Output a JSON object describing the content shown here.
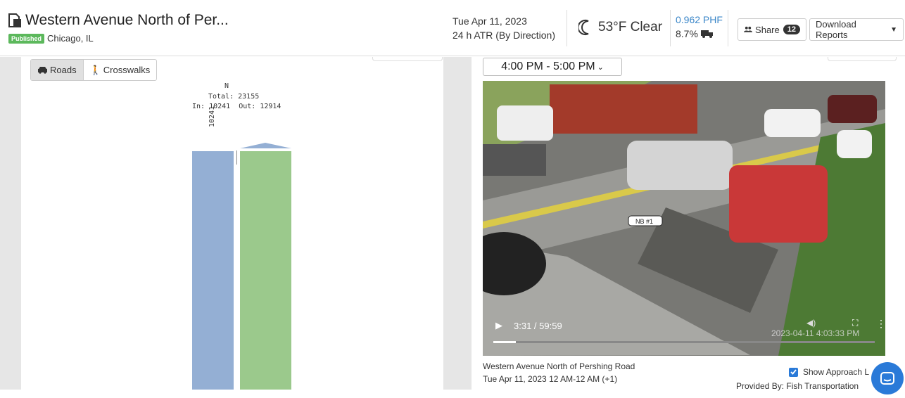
{
  "header": {
    "title": "Western Avenue North of Per...",
    "status_badge": "Published",
    "location": "Chicago, IL",
    "date": "Tue Apr 11, 2023",
    "report_type": "24 h ATR (By Direction)",
    "weather": "53°F Clear",
    "phf": "0.962 PHF",
    "truck_pct": "8.7%",
    "share_label": "Share",
    "share_count": "12",
    "download_label": "Download Reports"
  },
  "left": {
    "tabs": [
      "Roads",
      "Crosswalks"
    ],
    "active_tab": "Roads",
    "diagram": {
      "direction": "N",
      "total": "Total: 23155",
      "in_out": "In: 10241  Out: 12914",
      "in_value": "10241"
    }
  },
  "right": {
    "time_range": "4:00 PM - 5:00 PM",
    "video": {
      "time": "3:31 / 59:59",
      "progress": 0.059,
      "timestamp": "2023-04-11 4:03:33 PM",
      "overlay_label": "NB #1"
    },
    "info_lines": [
      "Western Avenue North of Pershing Road",
      "Tue Apr 11, 2023 12 AM-12 AM (+1)"
    ],
    "show_approach_label": "Show Approach L",
    "provided_by": "Provided By: Fish Transportation"
  },
  "colors": {
    "published": "#5cb85c",
    "accent": "#2a7ad8",
    "bar_in": "#94afd4",
    "bar_out": "#9bc98c"
  }
}
